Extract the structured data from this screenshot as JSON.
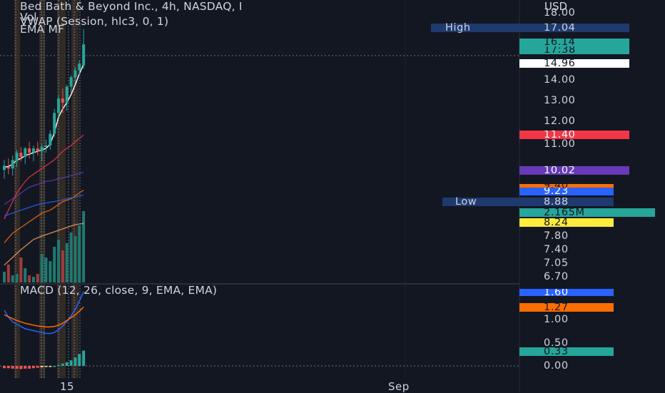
{
  "header": {
    "symbol_line": "Bed Bath & Beyond Inc., 4h, NASDAQ, I",
    "vol_label": "Vol",
    "vwap_label": "VWAP (Session, hlc3, 0, 1)",
    "ema_label": "EMA MF",
    "macd_label": "MACD (12, 26, close, 9, EMA, EMA)"
  },
  "price_axis": {
    "currency": "USD",
    "ticks": [
      "18.00",
      "14.00",
      "13.00",
      "12.00",
      "11.00",
      "7.80",
      "7.40",
      "7.05",
      "6.70"
    ]
  },
  "macd_axis": {
    "ticks": [
      "1.00",
      "0.50",
      "0.00"
    ]
  },
  "badges": {
    "high": {
      "label": "High",
      "value": "17.04",
      "color": "#1e3a6e"
    },
    "last": {
      "value": "16.14",
      "timer": "17:38",
      "color": "#26a69a"
    },
    "vwap": {
      "value": "14.96",
      "color": "#ffffff"
    },
    "ema_red": {
      "value": "11.40",
      "color": "#f23645"
    },
    "ema_purple": {
      "value": "10.02",
      "color": "#673ab7"
    },
    "ema_orange": {
      "value": "9.40",
      "color": "#ff6d00"
    },
    "ema_blue": {
      "value": "9.23",
      "color": "#2962ff"
    },
    "low": {
      "label": "Low",
      "value": "8.88",
      "color": "#1e3a6e"
    },
    "volume": {
      "value": "2.165M",
      "color": "#26a69a"
    },
    "ema_yellow": {
      "value": "8.24",
      "color": "#ffeb3b"
    },
    "macd_line": {
      "value": "1.60",
      "color": "#2962ff"
    },
    "macd_signal": {
      "value": "1.27",
      "color": "#ff6d00"
    },
    "macd_hist": {
      "value": "0.33",
      "color": "#26a69a"
    }
  },
  "time_axis": {
    "labels": [
      "15",
      "Sep"
    ]
  },
  "chart_data": {
    "type": "candlestick",
    "timeframe": "4h",
    "price_ylim": [
      6.5,
      18.3
    ],
    "candles": [
      {
        "o": 10.1,
        "h": 10.45,
        "l": 9.8,
        "c": 10.25
      },
      {
        "o": 10.2,
        "h": 10.5,
        "l": 9.95,
        "c": 10.15
      },
      {
        "o": 10.15,
        "h": 10.6,
        "l": 9.9,
        "c": 10.45
      },
      {
        "o": 10.4,
        "h": 10.8,
        "l": 10.2,
        "c": 10.7
      },
      {
        "o": 10.7,
        "h": 10.9,
        "l": 10.4,
        "c": 10.55
      },
      {
        "o": 10.55,
        "h": 10.9,
        "l": 10.3,
        "c": 10.85
      },
      {
        "o": 10.85,
        "h": 11.1,
        "l": 10.5,
        "c": 10.7
      },
      {
        "o": 10.7,
        "h": 10.95,
        "l": 10.4,
        "c": 10.85
      },
      {
        "o": 10.85,
        "h": 11.1,
        "l": 10.6,
        "c": 10.75
      },
      {
        "o": 10.75,
        "h": 11.0,
        "l": 10.4,
        "c": 10.9
      },
      {
        "o": 10.9,
        "h": 11.2,
        "l": 10.7,
        "c": 10.95
      },
      {
        "o": 10.95,
        "h": 11.6,
        "l": 10.8,
        "c": 11.45
      },
      {
        "o": 11.45,
        "h": 12.6,
        "l": 11.3,
        "c": 12.4
      },
      {
        "o": 12.4,
        "h": 13.3,
        "l": 12.2,
        "c": 13.1
      },
      {
        "o": 13.1,
        "h": 13.6,
        "l": 12.4,
        "c": 12.9
      },
      {
        "o": 12.9,
        "h": 13.8,
        "l": 12.5,
        "c": 13.7
      },
      {
        "o": 13.7,
        "h": 14.3,
        "l": 13.4,
        "c": 14.2
      },
      {
        "o": 14.2,
        "h": 14.8,
        "l": 13.9,
        "c": 14.6
      },
      {
        "o": 14.6,
        "h": 15.2,
        "l": 14.3,
        "c": 15.0
      },
      {
        "o": 14.9,
        "h": 17.04,
        "l": 14.7,
        "c": 16.14
      }
    ],
    "vwap": [
      10.2,
      10.22,
      10.3,
      10.45,
      10.5,
      10.6,
      10.65,
      10.7,
      10.75,
      10.8,
      10.85,
      11.0,
      11.5,
      12.2,
      12.6,
      12.9,
      13.3,
      13.8,
      14.4,
      14.96
    ],
    "ema_series": [
      {
        "color": "#f23645",
        "values": [
          8.4,
          8.7,
          9.0,
          9.3,
          9.5,
          9.7,
          9.85,
          9.95,
          10.05,
          10.15,
          10.25,
          10.35,
          10.45,
          10.6,
          10.75,
          10.85,
          10.95,
          11.1,
          11.25,
          11.4
        ]
      },
      {
        "color": "#673ab7",
        "values": [
          8.9,
          9.0,
          9.1,
          9.2,
          9.3,
          9.4,
          9.5,
          9.55,
          9.6,
          9.65,
          9.7,
          9.72,
          9.75,
          9.8,
          9.83,
          9.86,
          9.9,
          9.94,
          9.98,
          10.02
        ]
      },
      {
        "color": "#ff6d00",
        "values": [
          7.6,
          7.75,
          7.9,
          8.0,
          8.1,
          8.2,
          8.3,
          8.4,
          8.5,
          8.6,
          8.65,
          8.7,
          8.8,
          8.9,
          9.0,
          9.05,
          9.1,
          9.2,
          9.3,
          9.4
        ]
      },
      {
        "color": "#2962ff",
        "values": [
          8.5,
          8.55,
          8.6,
          8.65,
          8.7,
          8.75,
          8.8,
          8.85,
          8.9,
          8.92,
          8.95,
          8.98,
          9.0,
          9.03,
          9.06,
          9.1,
          9.13,
          9.16,
          9.2,
          9.23
        ]
      },
      {
        "color": "#f7a35c",
        "values": [
          7.0,
          7.1,
          7.2,
          7.3,
          7.4,
          7.5,
          7.6,
          7.7,
          7.75,
          7.8,
          7.85,
          7.9,
          7.95,
          8.0,
          8.05,
          8.1,
          8.15,
          8.2,
          8.22,
          8.24
        ]
      }
    ],
    "volume_relative": [
      0.15,
      0.25,
      0.1,
      0.12,
      0.35,
      0.2,
      0.1,
      0.08,
      0.12,
      0.4,
      0.35,
      0.3,
      0.5,
      0.6,
      0.45,
      0.55,
      0.7,
      0.65,
      0.8,
      1.0
    ],
    "macd_ylim": [
      -0.3,
      1.9
    ],
    "macd_line": [
      1.2,
      1.05,
      0.95,
      0.9,
      0.85,
      0.8,
      0.78,
      0.76,
      0.74,
      0.72,
      0.7,
      0.7,
      0.72,
      0.78,
      0.86,
      0.96,
      1.08,
      1.22,
      1.4,
      1.6
    ],
    "macd_signal": [
      1.1,
      1.06,
      1.02,
      0.98,
      0.95,
      0.92,
      0.9,
      0.88,
      0.86,
      0.85,
      0.84,
      0.84,
      0.85,
      0.88,
      0.92,
      0.98,
      1.04,
      1.1,
      1.18,
      1.27
    ],
    "macd_hist": [
      -0.05,
      -0.05,
      -0.06,
      -0.06,
      -0.07,
      -0.06,
      -0.06,
      -0.05,
      -0.04,
      -0.03,
      -0.02,
      -0.01,
      0.0,
      0.02,
      0.05,
      0.08,
      0.12,
      0.18,
      0.26,
      0.33
    ]
  }
}
